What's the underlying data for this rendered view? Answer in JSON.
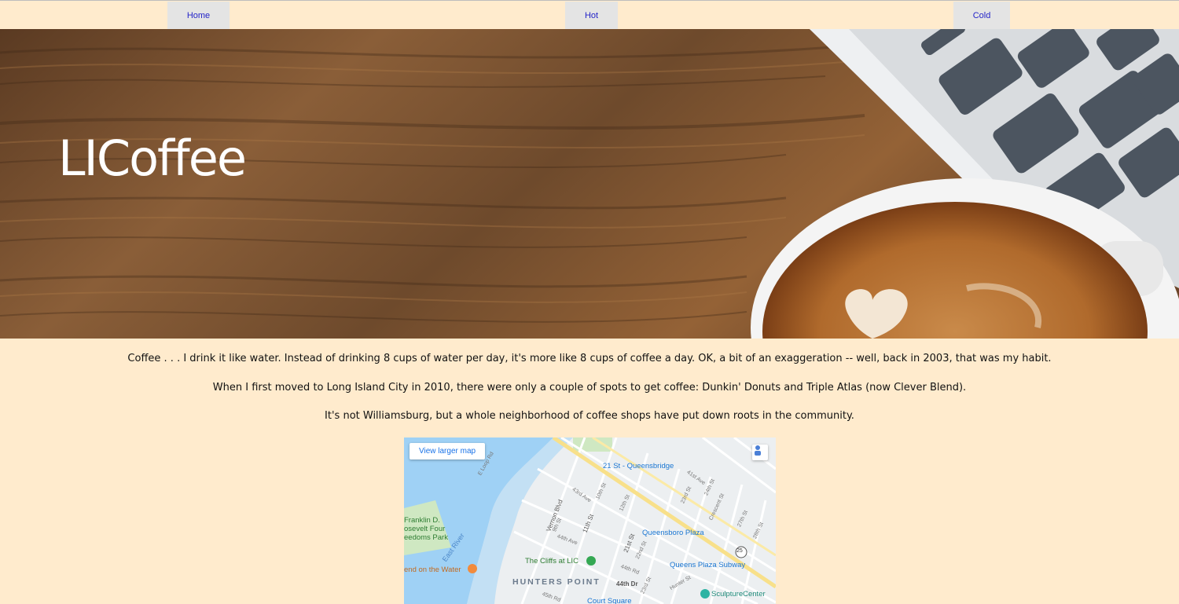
{
  "nav": {
    "items": [
      {
        "label": "Home"
      },
      {
        "label": "Hot"
      },
      {
        "label": "Cold"
      }
    ]
  },
  "hero": {
    "title": "LICoffee"
  },
  "intro": {
    "paragraphs": [
      "Coffee . . . I drink it like water. Instead of drinking 8 cups of water per day, it's more like 8 cups of coffee a day. OK, a bit of an exaggeration -- well, back in 2003, that was my habit.",
      "When I first moved to Long Island City in 2010, there were only a couple of spots to get coffee: Dunkin' Donuts and Triple Atlas (now Clever Blend).",
      "It's not Williamsburg, but a whole neighborhood of coffee shops have put down roots in the community."
    ]
  },
  "map": {
    "view_larger": "View larger map",
    "labels": {
      "station_21st": "21 St - Queensbridge",
      "queensboro_plaza": "Queensboro Plaza",
      "queens_plaza_subway": "Queens Plaza Subway",
      "cliffs": "The Cliffs at LIC",
      "hunters_point": "HUNTERS POINT",
      "east_river": "East River",
      "franklin_1": "Franklin D.",
      "franklin_2": "osevelt Four",
      "franklin_3": "eedoms Park",
      "end_on_water": "end on the Water",
      "sculpture": "SculptureCenter",
      "court_square": "Court Square",
      "vernon": "Vernon Blvd",
      "eleventh": "11th St",
      "twentyfirst": "21st St",
      "fortyfourth_dr": "44th Dr",
      "fortyfourth_ave": "44th Ave",
      "route25": "25",
      "e_loop": "E Loop Rd",
      "forty_first": "41st Ave",
      "hunter_st": "Hunter St",
      "forty_fourth_rd": "44th Rd",
      "forty_fifth_rd": "45th Rd",
      "forty_third_ave": "43rd Ave",
      "tenth_st": "10th St",
      "twelfth": "12th St",
      "crescent": "Crescent St",
      "twentythird": "23rd St",
      "twentyfourth": "24th St",
      "twentyseventh": "27th St",
      "twentyeighth": "28th St",
      "twentysecond": "22nd St",
      "ninth": "9th St",
      "twentythird_b": "23rd St"
    }
  }
}
